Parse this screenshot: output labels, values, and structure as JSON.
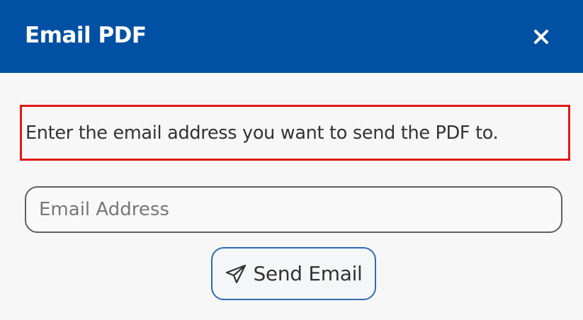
{
  "dialog": {
    "title": "Email PDF",
    "close_icon": "close-icon",
    "instruction": "Enter the email address you want to send the PDF to.",
    "email_input": {
      "value": "",
      "placeholder": "Email Address"
    },
    "send_button": {
      "label": "Send Email",
      "icon": "paper-plane-icon"
    }
  },
  "colors": {
    "header": "#0050a3",
    "highlight_border": "#e01818",
    "button_border": "#2f6bb3"
  }
}
